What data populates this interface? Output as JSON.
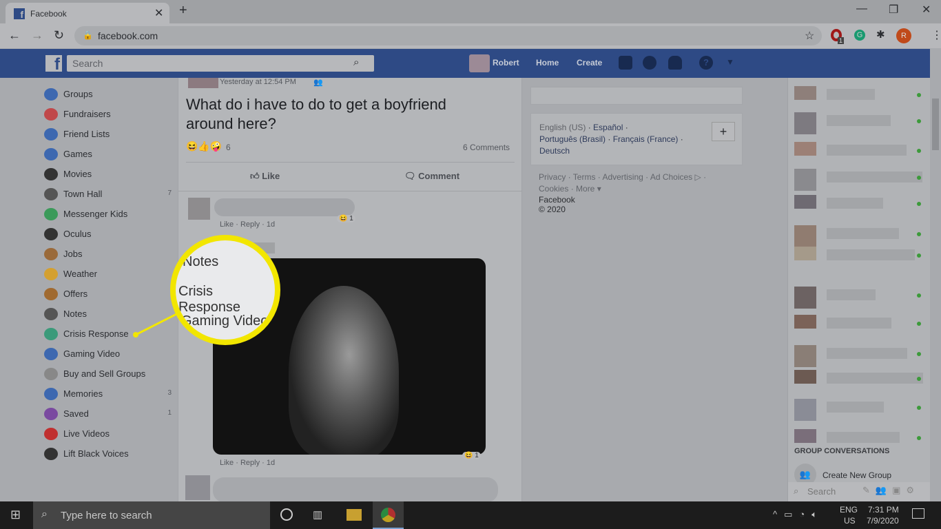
{
  "browser": {
    "tab_title": "Facebook",
    "url": "facebook.com",
    "profile_initial": "R",
    "ext_badge": "1"
  },
  "fb": {
    "search_placeholder": "Search",
    "user": "Robert",
    "home": "Home",
    "create": "Create"
  },
  "sidebar": [
    {
      "label": "Groups",
      "color": "#3d68b0"
    },
    {
      "label": "Fundraisers",
      "color": "#c0484a"
    },
    {
      "label": "Friend Lists",
      "color": "#3d68b0"
    },
    {
      "label": "Games",
      "color": "#3d68b0"
    },
    {
      "label": "Movies",
      "color": "#333"
    },
    {
      "label": "Town Hall",
      "count": "7",
      "color": "#555"
    },
    {
      "label": "Messenger Kids",
      "color": "#3b9a5a"
    },
    {
      "label": "Oculus",
      "color": "#333"
    },
    {
      "label": "Jobs",
      "color": "#9a6a3a"
    },
    {
      "label": "Weather",
      "color": "#d4a030"
    },
    {
      "label": "Offers",
      "color": "#a06a30"
    },
    {
      "label": "Notes",
      "color": "#555"
    },
    {
      "label": "Crisis Response",
      "color": "#3b9a7a"
    },
    {
      "label": "Gaming Video",
      "color": "#3d68b0"
    },
    {
      "label": "Buy and Sell Groups",
      "color": "#888"
    },
    {
      "label": "Memories",
      "count": "3",
      "color": "#3d68b0"
    },
    {
      "label": "Saved",
      "count": "1",
      "color": "#7a4aa0"
    },
    {
      "label": "Live Videos",
      "color": "#c03030"
    },
    {
      "label": "Lift Black Voices",
      "color": "#333"
    }
  ],
  "post": {
    "time": "Yesterday at 12:54 PM",
    "text": "What do i have to do to get a boyfriend around here?",
    "reactions": "6",
    "comments": "6 Comments",
    "like": "Like",
    "comment": "Comment",
    "c1": {
      "actions": "Like · Reply · 1d",
      "react": "1"
    },
    "c2": {
      "actions": "Like · Reply · 1d",
      "react": "1"
    }
  },
  "magnifier": {
    "lines": [
      "Notes",
      "Crisis Response",
      "Gaming Video"
    ],
    "border": "#f2e600"
  },
  "right": {
    "languages": [
      "English (US)",
      "Español",
      "Português (Brasil)",
      "Français (France)",
      "Deutsch"
    ],
    "links": "Privacy · Terms · Advertising · Ad Choices ▷ · Cookies · More ▾",
    "copyright": "Facebook © 2020"
  },
  "chat": {
    "group_heading": "GROUP CONVERSATIONS",
    "create_group": "Create New Group",
    "search": "Search"
  },
  "taskbar": {
    "search": "Type here to search",
    "lang1": "ENG",
    "lang2": "US",
    "time": "7:31 PM",
    "date": "7/9/2020"
  }
}
